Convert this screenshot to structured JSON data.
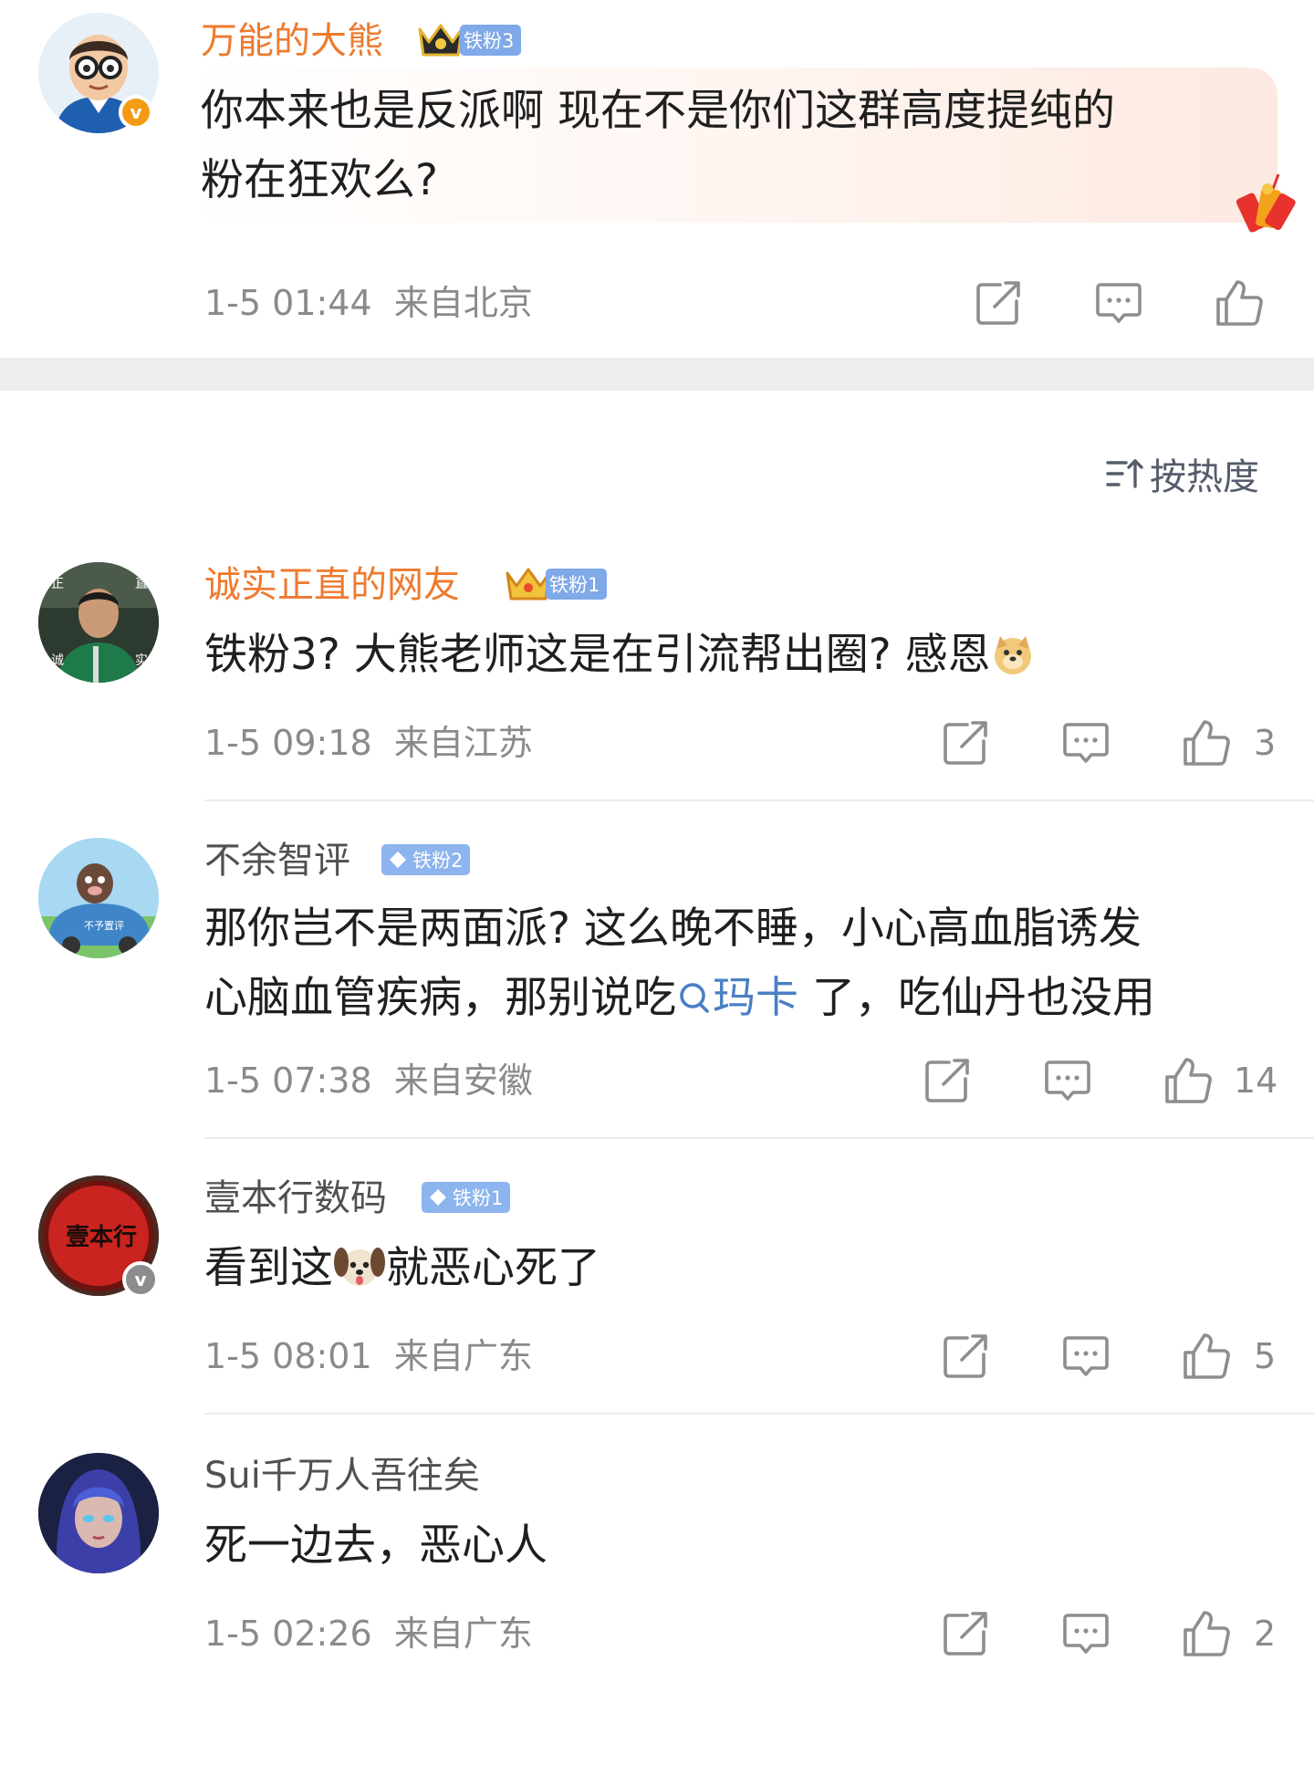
{
  "top_comment": {
    "username": "万能的大熊",
    "badge": "铁粉3",
    "text_lines": [
      "你本来也是反派啊 现在不是你们这群高度提纯的",
      "粉在狂欢么?"
    ],
    "date": "1-5 01:44",
    "location": "来自北京",
    "icons": {
      "share": "share-icon",
      "comment": "comment-icon",
      "like": "thumbs-up-icon"
    }
  },
  "sort": {
    "label": "按热度",
    "icon": "sort-icon"
  },
  "comments": [
    {
      "username": "诚实正直的网友",
      "badge": "铁粉1",
      "text": "铁粉3? 大熊老师这是在引流帮出圈? 感恩",
      "emoji": "doge-emoji",
      "date": "1-5 09:18",
      "location": "来自江苏",
      "likes": "3"
    },
    {
      "username": "不余智评",
      "badge": "铁粉2",
      "text_line1": "那你岂不是两面派? 这么晚不睡，小心高血脂诱发",
      "text_line2_prefix": "心脑血管疾病，那别说吃",
      "link_text": "玛卡",
      "text_line2_suffix": " 了，吃仙丹也没用",
      "date": "1-5 07:38",
      "location": "来自安徽",
      "likes": "14"
    },
    {
      "username": "壹本行数码",
      "badge": "铁粉1",
      "text_prefix": "看到这",
      "emoji": "dog-emoji",
      "text_suffix": "就恶心死了",
      "date": "1-5 08:01",
      "location": "来自广东",
      "likes": "5"
    },
    {
      "username": "Sui千万人吾往矣",
      "text": "死一边去，恶心人",
      "date": "1-5 02:26",
      "location": "来自广东",
      "likes": "2"
    }
  ],
  "colors": {
    "vip_orange": "#ee7a2f",
    "badge_blue": "#7fa9e8",
    "link_blue": "#4a7fc4",
    "meta_gray": "#8a8a8a"
  }
}
